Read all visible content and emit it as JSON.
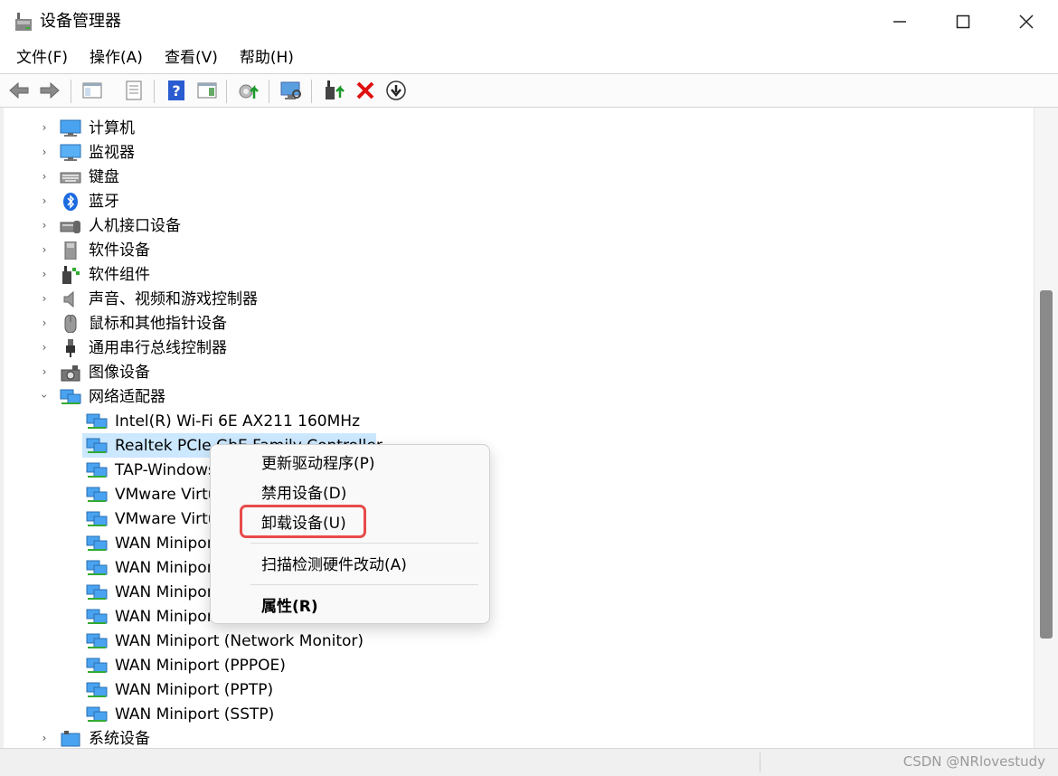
{
  "window": {
    "title": "设备管理器"
  },
  "menu": [
    {
      "label": "文件(F)"
    },
    {
      "label": "操作(A)"
    },
    {
      "label": "查看(V)"
    },
    {
      "label": "帮助(H)"
    }
  ],
  "tree": {
    "categories_top": [
      {
        "label": "计算机",
        "icon": "computer-icon"
      },
      {
        "label": "监视器",
        "icon": "monitor-icon"
      },
      {
        "label": "键盘",
        "icon": "keyboard-icon"
      },
      {
        "label": "蓝牙",
        "icon": "bluetooth-icon"
      },
      {
        "label": "人机接口设备",
        "icon": "hid-icon"
      },
      {
        "label": "软件设备",
        "icon": "software-device-icon"
      },
      {
        "label": "软件组件",
        "icon": "software-component-icon"
      },
      {
        "label": "声音、视频和游戏控制器",
        "icon": "speaker-icon"
      },
      {
        "label": "鼠标和其他指针设备",
        "icon": "mouse-icon"
      },
      {
        "label": "通用串行总线控制器",
        "icon": "usb-icon"
      },
      {
        "label": "图像设备",
        "icon": "camera-icon"
      }
    ],
    "expanded_category": {
      "label": "网络适配器",
      "icon": "network-adapter-icon"
    },
    "network_adapters": [
      {
        "label": "Intel(R) Wi-Fi 6E AX211 160MHz"
      },
      {
        "label": "Realtek PCIe GbE Family Controller"
      },
      {
        "label": "TAP-Windows Adapter V9"
      },
      {
        "label": "VMware Virtual Ethernet Adapter for VMnet1"
      },
      {
        "label": "VMware Virtual Ethernet Adapter for VMnet8"
      },
      {
        "label": "WAN Miniport (IKEv2)"
      },
      {
        "label": "WAN Miniport (IP)"
      },
      {
        "label": "WAN Miniport (IPv6)"
      },
      {
        "label": "WAN Miniport (L2TP)"
      },
      {
        "label": "WAN Miniport (Network Monitor)"
      },
      {
        "label": "WAN Miniport (PPPOE)"
      },
      {
        "label": "WAN Miniport (PPTP)"
      },
      {
        "label": "WAN Miniport (SSTP)"
      }
    ],
    "selected_index": 1,
    "last_category": {
      "label": "系统设备"
    }
  },
  "context_menu": {
    "update_driver": "更新驱动程序(P)",
    "disable_device": "禁用设备(D)",
    "uninstall_device": "卸载设备(U)",
    "scan_hardware": "扫描检测硬件改动(A)",
    "properties": "属性(R)"
  },
  "watermark": "CSDN @NRlovestudy",
  "colors": {
    "selection": "#cce8ff",
    "highlight_border": "#e84a4a",
    "delete_red": "#e01010"
  }
}
